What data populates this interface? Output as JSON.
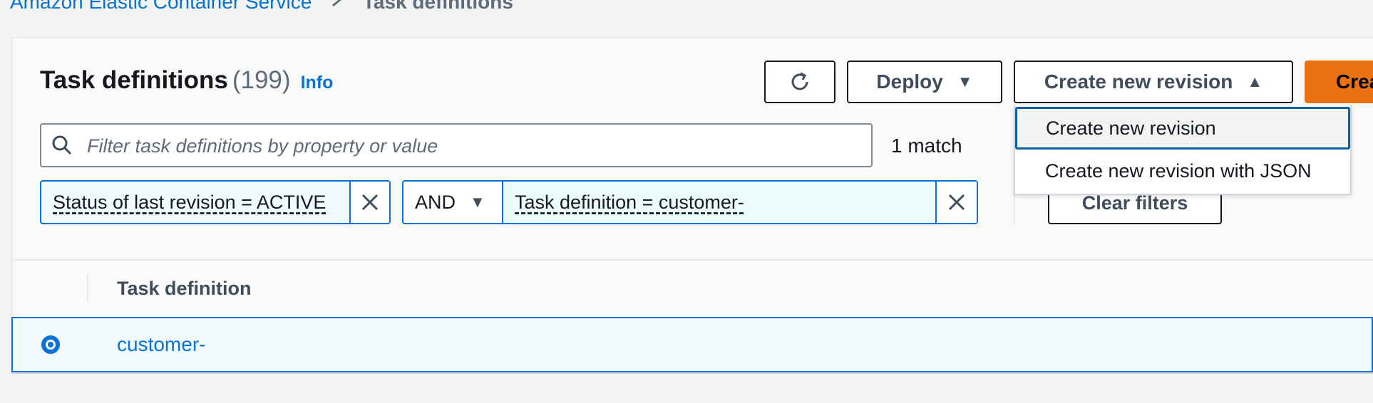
{
  "breadcrumb": {
    "service": "Amazon Elastic Container Service",
    "current": "Task definitions"
  },
  "header": {
    "title": "Task definitions",
    "count": "(199)",
    "info": "Info"
  },
  "toolbar": {
    "refresh_icon": "refresh-icon",
    "deploy_label": "Deploy",
    "create_revision_label": "Create new revision",
    "create_label": "Crea"
  },
  "dropdown": {
    "items": [
      "Create new revision",
      "Create new revision with JSON"
    ]
  },
  "filter": {
    "placeholder": "Filter task definitions by property or value",
    "value": "",
    "match_count": "1 match",
    "tokens": [
      {
        "label": "Status of last revision = ACTIVE"
      },
      {
        "operator": "AND",
        "label": "Task definition = customer-"
      }
    ],
    "clear_label": "Clear filters"
  },
  "table": {
    "columns": [
      "Task definition"
    ],
    "rows": [
      {
        "name": "customer-",
        "selected": true
      }
    ]
  },
  "colors": {
    "accent": "#0972d3",
    "primary_button": "#ec7211"
  }
}
